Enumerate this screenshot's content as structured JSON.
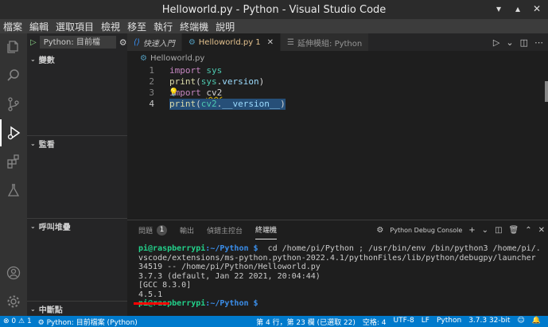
{
  "window": {
    "title": "Helloworld.py - Python - Visual Studio Code"
  },
  "menu": [
    "檔案",
    "編輯",
    "選取項目",
    "檢視",
    "移至",
    "執行",
    "終端機",
    "說明"
  ],
  "sidebar": {
    "run_config": "Python: 目前檔",
    "sections": [
      "變數",
      "監看",
      "呼叫堆疊",
      "中斷點"
    ]
  },
  "tabs": [
    {
      "label": "快速入門",
      "icon": "vscode-icon"
    },
    {
      "label": "Helloworld.py 1",
      "icon": "python-icon"
    },
    {
      "label": "延伸模組: Python",
      "icon": "extensions-icon"
    }
  ],
  "breadcrumb": "Helloworld.py",
  "code": [
    {
      "num": "1",
      "text": "import sys"
    },
    {
      "num": "2",
      "text": "print(sys.version)"
    },
    {
      "num": "3",
      "text": "import cv2"
    },
    {
      "num": "4",
      "text": "print(cv2.__version__)"
    }
  ],
  "panel": {
    "tabs": [
      "問題",
      "輸出",
      "偵錯主控台",
      "終端機"
    ],
    "problems_count": "1",
    "terminal_selector": "Python Debug Console",
    "terminal_lines": [
      "pi@raspberrypi:~/Python $  cd /home/pi/Python ; /usr/bin/env /bin/python3 /home/pi/.",
      "vscode/extensions/ms-python.python-2022.4.1/pythonFiles/lib/python/debugpy/launcher",
      "34519 -- /home/pi/Python/Helloworld.py",
      "3.7.3 (default, Jan 22 2021, 20:04:44)",
      "[GCC 8.3.0]",
      "4.5.1",
      "pi@raspberrypi:~/Python $"
    ],
    "prompt_user": "pi@raspberrypi",
    "prompt_path": ":~/Python $"
  },
  "status": {
    "errors": "0",
    "warnings": "1",
    "debug": "Python: 目前檔案 (Python)",
    "position": "第 4 行，第 23 欄 (已選取 22)",
    "spaces": "空格: 4",
    "encoding": "UTF-8",
    "eol": "LF",
    "language": "Python",
    "interpreter": "3.7.3 32-bit"
  },
  "colors": {
    "accent": "#007acc",
    "activity_bar": "#333333",
    "editor_bg": "#1e1e1e",
    "prompt_green": "#23d18b",
    "prompt_blue": "#3b8eea"
  }
}
